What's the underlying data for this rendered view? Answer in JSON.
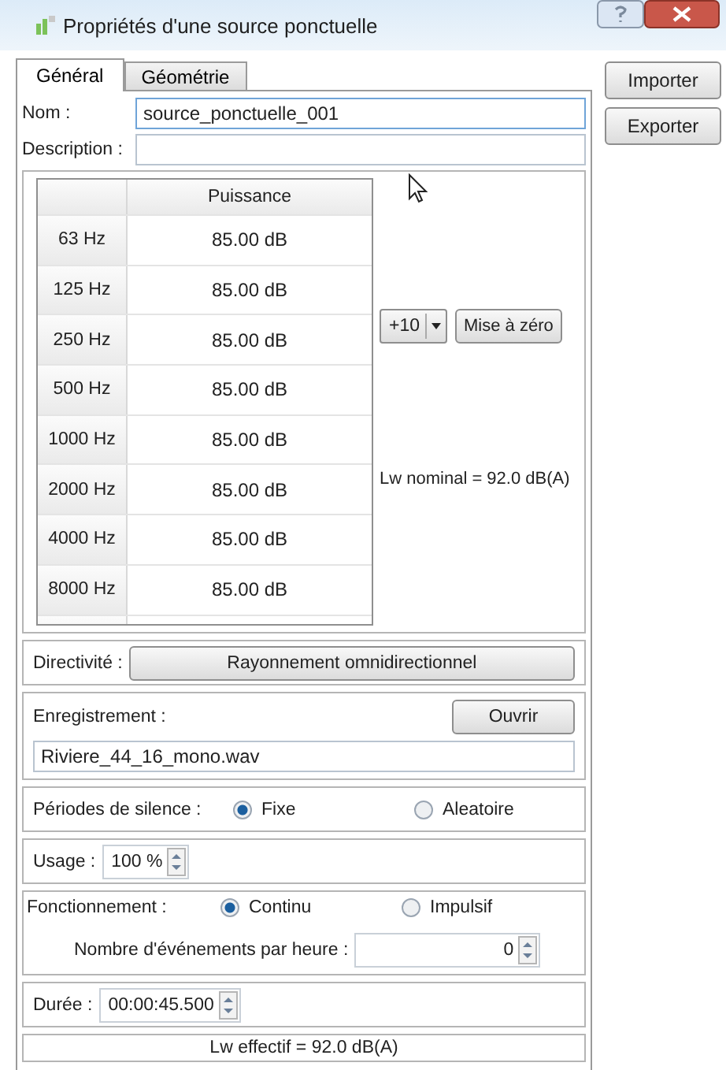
{
  "window": {
    "title": "Propriétés d'une source ponctuelle"
  },
  "tabs": [
    {
      "label": "Général",
      "selected": true
    },
    {
      "label": "Géométrie",
      "selected": false
    }
  ],
  "side_buttons": [
    "Importer",
    "Exporter"
  ],
  "name": {
    "label": "Nom :",
    "value": "source_ponctuelle_001"
  },
  "description": {
    "label": "Description :"
  },
  "spectrum": {
    "column": "Puissance",
    "rows": [
      {
        "band": "63 Hz",
        "value": "85.00 dB"
      },
      {
        "band": "125 Hz",
        "value": "85.00 dB"
      },
      {
        "band": "250 Hz",
        "value": "85.00 dB"
      },
      {
        "band": "500 Hz",
        "value": "85.00 dB"
      },
      {
        "band": "1000 Hz",
        "value": "85.00 dB"
      },
      {
        "band": "2000 Hz",
        "value": "85.00 dB"
      },
      {
        "band": "4000 Hz",
        "value": "85.00 dB"
      },
      {
        "band": "8000 Hz",
        "value": "85.00 dB"
      }
    ],
    "increment": "+10",
    "reset_button": "Mise à zéro",
    "nominal": "Lw nominal = 92.0 dB(A)"
  },
  "directivity": {
    "label": "Directivité :",
    "button": "Rayonnement omnidirectionnel"
  },
  "recording": {
    "label": "Enregistrement :",
    "button": "Ouvrir",
    "value": "Riviere_44_16_mono.wav"
  },
  "silence": {
    "label": "Périodes de silence :",
    "options": [
      {
        "label": "Fixe",
        "selected": true
      },
      {
        "label": "Aleatoire",
        "selected": false
      }
    ]
  },
  "usage": {
    "label": "Usage :",
    "value": "100 %"
  },
  "operation": {
    "label": "Fonctionnement :",
    "options": [
      {
        "label": "Continu",
        "selected": true
      },
      {
        "label": "Impulsif",
        "selected": false
      }
    ],
    "events_label": "Nombre d'événements par heure :",
    "events_value": "0"
  },
  "duration": {
    "label": "Durée :",
    "value": "00:00:45.500"
  },
  "effective": "Lw effectif = 92.0 dB(A)"
}
